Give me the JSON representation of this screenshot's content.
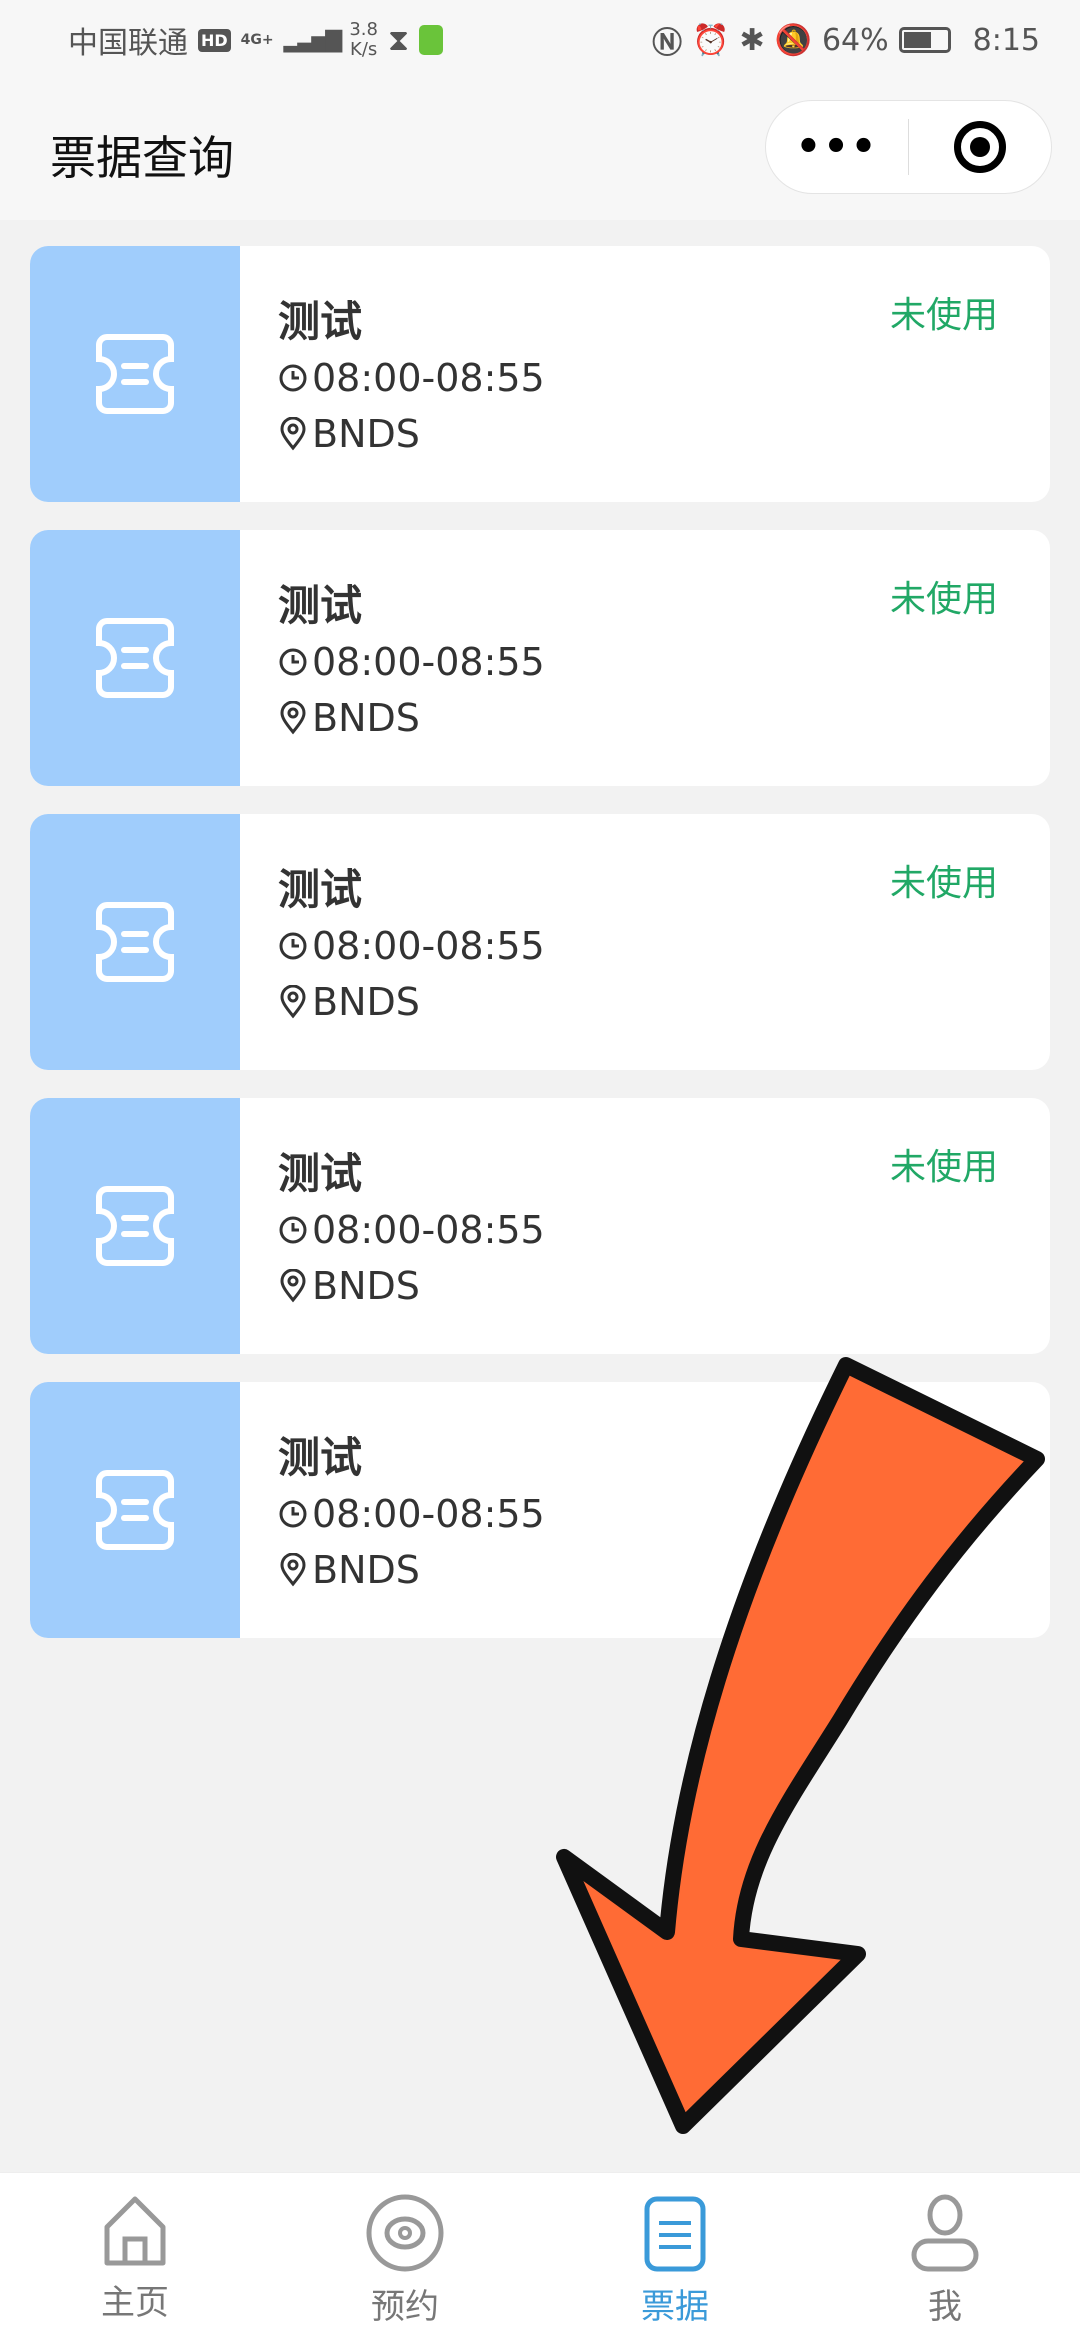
{
  "status_bar": {
    "carrier": "中国联通",
    "hd": "HD",
    "network": "4G+",
    "speed_value": "3.8",
    "speed_unit": "K/s",
    "battery": "64%",
    "battery_level": 0.64,
    "time": "8:15"
  },
  "header": {
    "title": "票据查询",
    "more_label": "•••"
  },
  "tickets": [
    {
      "name": "测试",
      "time": "08:00-08:55",
      "location": "BNDS",
      "status": "未使用"
    },
    {
      "name": "测试",
      "time": "08:00-08:55",
      "location": "BNDS",
      "status": "未使用"
    },
    {
      "name": "测试",
      "time": "08:00-08:55",
      "location": "BNDS",
      "status": "未使用"
    },
    {
      "name": "测试",
      "time": "08:00-08:55",
      "location": "BNDS",
      "status": "未使用"
    },
    {
      "name": "测试",
      "time": "08:00-08:55",
      "location": "BNDS",
      "status": ""
    }
  ],
  "tabbar": {
    "items": [
      {
        "label": "主页",
        "icon": "home-icon"
      },
      {
        "label": "预约",
        "icon": "eye-icon"
      },
      {
        "label": "票据",
        "icon": "ticket-list-icon",
        "active": true
      },
      {
        "label": "我",
        "icon": "user-icon"
      }
    ]
  },
  "colors": {
    "status_green": "#21a866",
    "thumb_blue": "#a0cdfc",
    "active_tab": "#3a9ad9",
    "annotation_arrow": "#ff6b35"
  }
}
